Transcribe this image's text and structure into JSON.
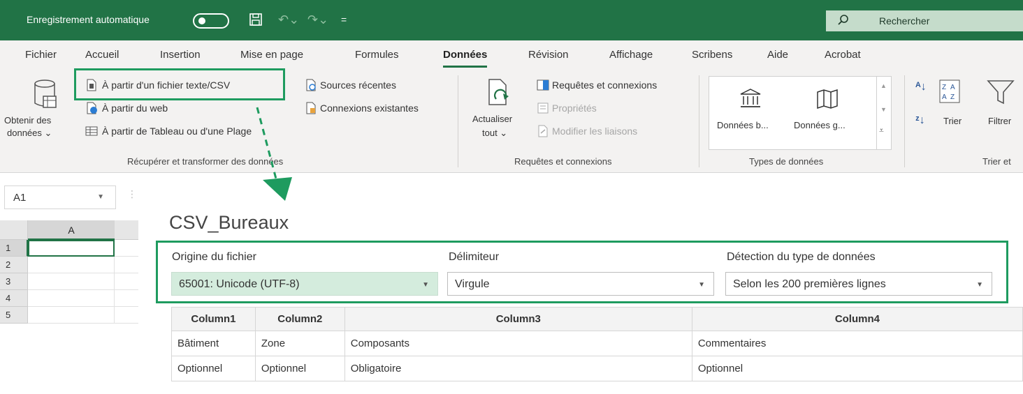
{
  "titlebar": {
    "autosave_label": "Enregistrement automatique",
    "search_label": "Rechercher"
  },
  "ribbon": {
    "tabs": [
      "Fichier",
      "Accueil",
      "Insertion",
      "Mise en page",
      "Formules",
      "Données",
      "Révision",
      "Affichage",
      "Scribens",
      "Aide",
      "Acrobat"
    ],
    "active_tab": "Données",
    "get_data": {
      "obtain_line1": "Obtenir des",
      "obtain_line2": "données ⌄",
      "from_text_csv": "À partir d'un fichier texte/CSV",
      "from_web": "À partir du web",
      "from_table": "À partir de Tableau ou d'une Plage",
      "recent_sources": "Sources récentes",
      "existing_connections": "Connexions existantes",
      "group_label": "Récupérer et transformer des données"
    },
    "queries": {
      "refresh_line1": "Actualiser",
      "refresh_line2": "tout ⌄",
      "queries_connections": "Requêtes et connexions",
      "properties": "Propriétés",
      "edit_links": "Modifier les liaisons",
      "group_label": "Requêtes et connexions"
    },
    "data_types": {
      "stocks": "Données b...",
      "geography": "Données g...",
      "group_label": "Types de données"
    },
    "sort": {
      "sort_label": "Trier",
      "filter_label": "Filtrer",
      "group_label": "Trier et"
    }
  },
  "grid": {
    "namebox": "A1",
    "column": "A",
    "rows": [
      "1",
      "2",
      "3",
      "4",
      "5"
    ]
  },
  "import": {
    "title": "CSV_Bureaux",
    "file_origin_label": "Origine du fichier",
    "file_origin_value": "65001: Unicode (UTF-8)",
    "delimiter_label": "Délimiteur",
    "delimiter_value": "Virgule",
    "detection_label": "Détection du type de données",
    "detection_value": "Selon les 200 premières lignes",
    "columns": [
      "Column1",
      "Column2",
      "Column3",
      "Column4"
    ],
    "rows": [
      [
        "Bâtiment",
        "Zone",
        "Composants",
        "Commentaires"
      ],
      [
        "Optionnel",
        "Optionnel",
        "Obligatoire",
        "Optionnel"
      ]
    ]
  },
  "colors": {
    "brand": "#217346",
    "highlight": "#1e9b5f"
  }
}
